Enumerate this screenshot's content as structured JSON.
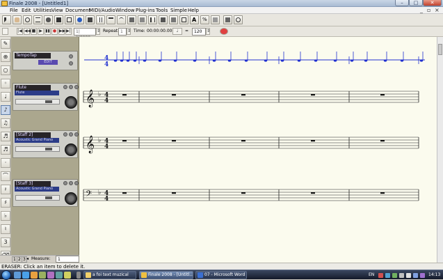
{
  "window": {
    "title": "Finale 2008 - [Untitled1]",
    "min": "–",
    "max": "□",
    "close": "✕"
  },
  "menus": [
    "File",
    "Edit",
    "Utilities",
    "View",
    "Document",
    "MIDI/Audio",
    "Window",
    "Plug-ins",
    "Tools",
    "Simple",
    "Help"
  ],
  "mdi_controls": {
    "min": "_",
    "max": "▫",
    "close": "×"
  },
  "playback": {
    "counter": "1| 1|0000",
    "repeat_label": "Repeat:",
    "repeat_value": "1",
    "time_label": "Time:",
    "time_value": "00:00:00.000",
    "tempo_sign": "=",
    "tempo_value": "120"
  },
  "mixer": {
    "tempotap_name": "TempoTap",
    "tempotap_button": "EDIT",
    "strips": [
      {
        "name": "Flute",
        "patch": "Flute"
      },
      {
        "name": "[Staff 2]",
        "patch": "Acoustic Grand Piano"
      },
      {
        "name": "[Staff 3]",
        "patch": "Acoustic Grand Piano"
      }
    ]
  },
  "nav": {
    "pages": [
      "1",
      "2",
      "3"
    ],
    "measure_label": "Measure:",
    "measure_value": "1"
  },
  "status": {
    "text": "ERASER: Click an item to delete it."
  },
  "score": {
    "time_sig_num": "4",
    "time_sig_den": "4",
    "flat": "♭"
  },
  "taskbar": {
    "tasks": [
      {
        "label": "a foi text muzical",
        "icon_color": "#f2d06b"
      },
      {
        "label": "Finale 2008 - [Untitl...",
        "icon_color": "#f0c040"
      },
      {
        "label": "07 - Microsoft Word",
        "icon_color": "#3b6fd1"
      }
    ],
    "language": "EN",
    "clock": "14:13"
  },
  "colors": {
    "tempo_line": "#2030d0",
    "score_bg": "#fbfbee",
    "mixer_bg": "#aba78e",
    "patch_bg": "#2c3c88"
  }
}
